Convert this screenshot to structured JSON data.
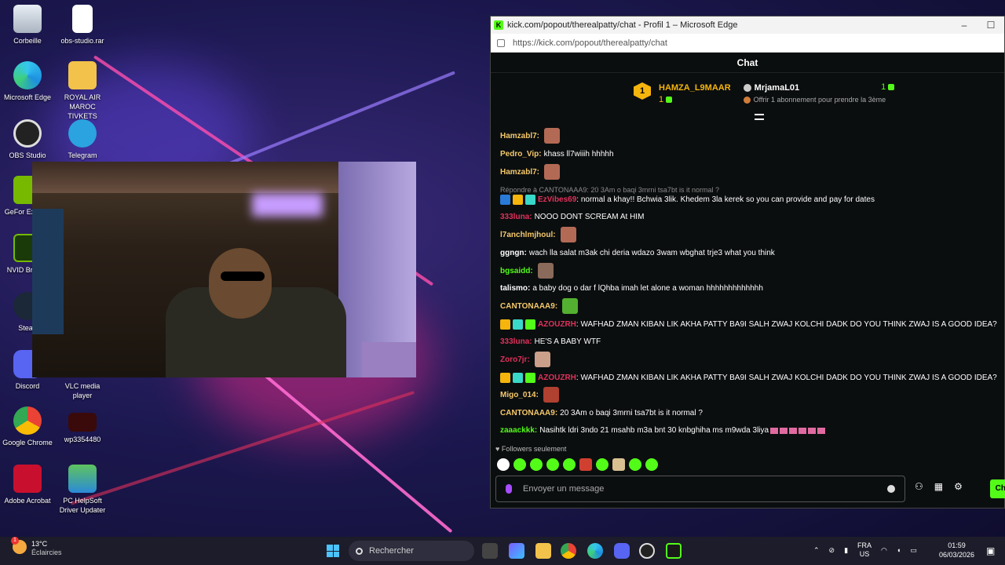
{
  "desktop": {
    "icons": [
      {
        "label": "Corbeille"
      },
      {
        "label": "obs-studio.rar"
      },
      {
        "label": "Microsoft Edge"
      },
      {
        "label": "ROYAL AIR MAROC TIVKETS"
      },
      {
        "label": "OBS Studio"
      },
      {
        "label": "Telegram"
      },
      {
        "label": "GeFor Experie"
      },
      {
        "label": "NVID Broadc"
      },
      {
        "label": "Stean"
      },
      {
        "label": "Discord"
      },
      {
        "label": "VLC media player"
      },
      {
        "label": "Google Chrome"
      },
      {
        "label": "wp3354480"
      },
      {
        "label": "Adobe Acrobat"
      },
      {
        "label": "PC HelpSoft Driver Updater"
      }
    ]
  },
  "browser": {
    "title": "kick.com/popout/therealpatty/chat - Profil 1 – Microsoft Edge",
    "url": "https://kick.com/popout/therealpatty/chat",
    "minimize": "–",
    "maximize": "☐"
  },
  "chat": {
    "heading": "Chat",
    "leaderboard": {
      "rank": "1",
      "top_user": "HAMZA_L9MAAR",
      "top_count": "1",
      "second_user": "MrjamaL01",
      "second_count": "1",
      "cta": "Offrir 1 abonnement pour prendre la 3ème"
    },
    "messages": [
      {
        "user": "Hamzabl7:",
        "text": "",
        "color": "#f5c96b",
        "emote": true
      },
      {
        "user": "Pedro_Vip:",
        "text": "khass ll7wiiih hhhhh",
        "color": "#f5c96b"
      },
      {
        "user": "Hamzabl7:",
        "text": "",
        "color": "#f5c96b",
        "emote": true
      },
      {
        "reply": "Répondre à CANTONAAA9: 20 3Am o baqi 3mrni tsa7bt is it normal ?"
      },
      {
        "user": "EzVibes69",
        "text": ": normal a khay!! Bchwia 3lik. Khedem 3la kerek so you can provide and pay for dates",
        "color": "#e0315b",
        "badges": 3
      },
      {
        "user": "333luna:",
        "text": "NOOO DONT SCREAM At HIM",
        "color": "#e0315b"
      },
      {
        "user": "l7anchlmjhoul:",
        "text": "",
        "color": "#f5c96b",
        "emote": true
      },
      {
        "user": "ggngn:",
        "text": "wach lla salat m3ak chi deria wdazo 3wam wbghat trje3 what you think",
        "color": "#ffffff"
      },
      {
        "user": "bgsaidd:",
        "text": "",
        "color": "#53fc18",
        "emote": true
      },
      {
        "user": "talismo:",
        "text": "a baby dog o dar f lQhba imah let alone a woman hhhhhhhhhhhhh",
        "color": "#ffffff"
      },
      {
        "user": "CANTONAAA9:",
        "text": "",
        "color": "#f5c96b",
        "emote": true
      },
      {
        "user": "AZOUZRH",
        "text": ": WAFHAD ZMAN KIBAN LIK AKHA PATTY BA9I SALH ZWAJ KOLCHI DADK DO YOU THINK ZWAJ IS A GOOD IDEA?",
        "color": "#e0315b",
        "badges": 3
      },
      {
        "user": "333luna:",
        "text": "HE'S A BABY WTF",
        "color": "#e0315b"
      },
      {
        "user": "Zoro7jr:",
        "text": "",
        "color": "#e0315b",
        "emote": true
      },
      {
        "user": "AZOUZRH",
        "text": ": WAFHAD ZMAN KIBAN LIK AKHA PATTY BA9I SALH ZWAJ KOLCHI DADK DO YOU THINK ZWAJ IS A GOOD IDEA?",
        "color": "#e0315b",
        "badges": 3
      },
      {
        "user": "Migo_014:",
        "text": "",
        "color": "#f5c96b",
        "emote": true
      },
      {
        "user": "CANTONAAA9:",
        "text": "20 3Am o baqi 3mrni tsa7bt is it normal ?",
        "color": "#f5c96b"
      },
      {
        "user": "zaaackkk:",
        "text": "Nasihtk ldri 3ndo 21 msahb m3a bnt 30 knbghiha ms m9wda 3liya",
        "color": "#53fc18"
      }
    ],
    "followers_only": "Followers seulement",
    "input_placeholder": "Envoyer un message",
    "send_label": "Ch"
  },
  "taskbar": {
    "temperature": "13°C",
    "weather": "Éclaircies",
    "weather_badge": "1",
    "search_placeholder": "Rechercher",
    "language": "FRA",
    "region": "US",
    "time": "01:59",
    "date": "06/03/2026"
  },
  "colors": {
    "kick_green": "#53fc18",
    "chat_bg": "#0b0e0f",
    "gold": "#f5b50d"
  }
}
